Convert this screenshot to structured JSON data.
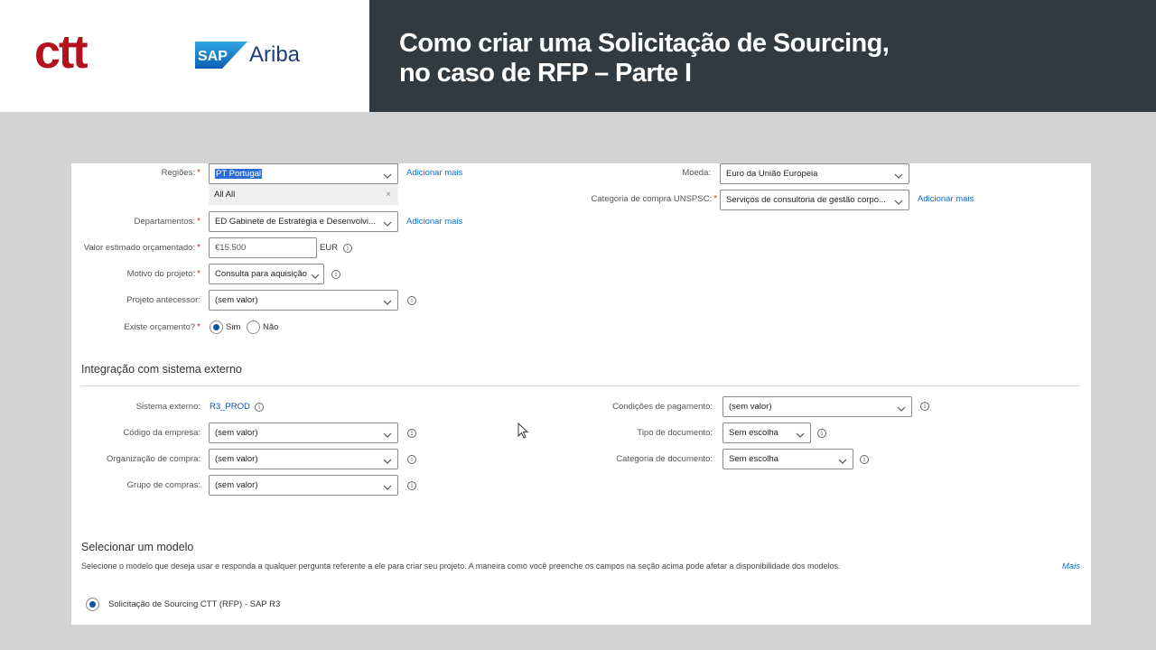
{
  "banner": {
    "ctt_logo": "ctt",
    "sap_logo": "SAP",
    "ariba_logo": "Ariba",
    "title_line1": "Como criar uma Solicitação de Sourcing,",
    "title_line2": "no caso de RFP – Parte I",
    "colors": {
      "ctt_red": "#b3121f",
      "sap_blue": "#0a6ed1",
      "dark": "#303a40"
    }
  },
  "form": {
    "regioes": {
      "label": "Regiões:",
      "value": "PT Portugal",
      "option": "All All",
      "add_more": "Adicionar mais"
    },
    "departamentos": {
      "label": "Departamentos:",
      "value": "ED Gabinete de Estratégia e Desenvolvi...",
      "add_more": "Adicionar mais"
    },
    "valor": {
      "label": "Valor estimado orçamentado:",
      "value": "€15.500",
      "currency": "EUR"
    },
    "motivo": {
      "label": "Motivo do projeto:",
      "value": "Consulta para aquisição"
    },
    "antecessor": {
      "label": "Projeto antecessor:",
      "value": "(sem valor)"
    },
    "orcamento": {
      "label": "Existe orçamento?",
      "yes": "Sim",
      "no": "Não",
      "selected": "Sim"
    },
    "moeda": {
      "label": "Moeda:",
      "value": "Euro da União Europeia"
    },
    "categoria": {
      "label": "Categoria de compra UNSPSC:",
      "value": "Serviços de consultoria de gestão corpo...",
      "add_more": "Adicionar mais"
    },
    "required_mark": "*"
  },
  "integracao": {
    "title": "Integração com sistema externo",
    "sistema": {
      "label": "Sistema externo:",
      "value": "R3_PROD"
    },
    "codigo": {
      "label": "Código da empresa:",
      "value": "(sem valor)"
    },
    "organizacao": {
      "label": "Organização de compra:",
      "value": "(sem valor)"
    },
    "grupo": {
      "label": "Grupo de compras:",
      "value": "(sem valor)"
    },
    "condicoes": {
      "label": "Condições de pagamento:",
      "value": "(sem valor)"
    },
    "tipo": {
      "label": "Tipo de documento:",
      "value": "Sem escolha"
    },
    "categoria_doc": {
      "label": "Categoria de documento:",
      "value": "Sem escolha"
    }
  },
  "modelo": {
    "title": "Selecionar um modelo",
    "description": "Selecione o modelo que deseja usar e responda a qualquer pergunta referente a ele para criar seu projeto. A maneira como você preenche os campos na seção acima pode afetar a disponibilidade dos modelos.",
    "more": "Mais",
    "option": "Solicitação de Sourcing CTT (RFP) - SAP R3"
  },
  "icons": {
    "info": "i",
    "close": "×"
  }
}
